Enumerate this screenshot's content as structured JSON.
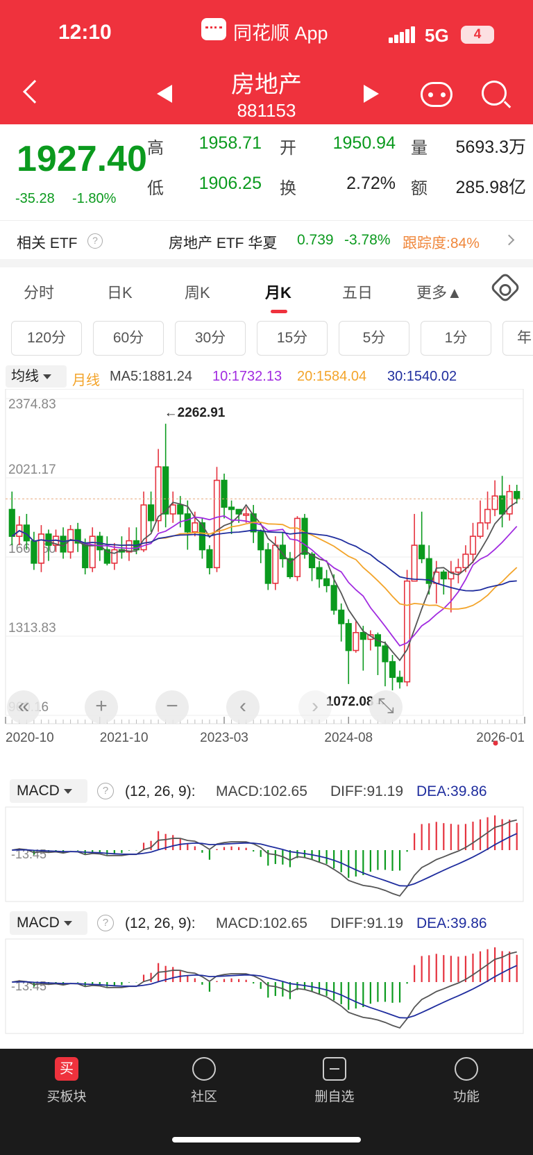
{
  "status_bar": {
    "time": "12:10",
    "app": "同花顺 App",
    "network": "5G",
    "battery": "4"
  },
  "header": {
    "title": "房地产",
    "code": "881153"
  },
  "quote": {
    "price": "1927.40",
    "change": "-35.28",
    "change_pct": "-1.80%",
    "high_label": "高",
    "high": "1958.71",
    "open_label": "开",
    "open": "1950.94",
    "volume_label": "量",
    "volume": "5693.3万",
    "low_label": "低",
    "low": "1906.25",
    "turnover_label": "换",
    "turnover": "2.72%",
    "amount_label": "额",
    "amount": "285.98亿"
  },
  "etf": {
    "label": "相关 ETF",
    "help": "?",
    "name": "房地产 ETF 华夏",
    "price": "0.739",
    "pct": "-3.78%",
    "tracking": "跟踪度:84%"
  },
  "tabs": [
    "分时",
    "日K",
    "周K",
    "月K",
    "五日",
    "更多▲"
  ],
  "active_tab": "月K",
  "periods": [
    "120分",
    "60分",
    "30分",
    "15分",
    "5分",
    "1分",
    "年"
  ],
  "ma": {
    "select": "均线",
    "type": "月线",
    "ma5": "MA5:1881.24",
    "ma10": "10:1732.13",
    "ma20": "20:1584.04",
    "ma30": "30:1540.02"
  },
  "colors": {
    "red": "#e5323e",
    "green": "#0b9a1e",
    "ma5": "#555555",
    "ma10": "#a12be0",
    "ma20": "#f3a42a",
    "ma30": "#1f2d9e"
  },
  "chart_labels": {
    "y_ticks": [
      "2374.83",
      "2021.17",
      "1667.50",
      "1313.83",
      "960.16"
    ],
    "high_marker": "←2262.91",
    "low_marker": "1072.08→",
    "x_ticks": [
      "2020-10",
      "2021-10",
      "2023-03",
      "2024-08",
      "2026-01"
    ]
  },
  "controls": [
    "«",
    "+",
    "−",
    "‹",
    "›",
    "⤡"
  ],
  "macd": {
    "select": "MACD",
    "help": "?",
    "params": "(12, 26, 9):",
    "macd": "MACD:102.65",
    "diff": "DIFF:91.19",
    "dea": "DEA:39.86",
    "axis": "-13.45"
  },
  "bottom_nav": [
    "买板块",
    "社区",
    "删自选",
    "功能"
  ],
  "chart_data": {
    "type": "candlestick",
    "period": "monthly",
    "ylim": [
      960.16,
      2374.83
    ],
    "y_ticks": [
      2374.83,
      2021.17,
      1667.5,
      1313.83,
      960.16
    ],
    "x_ticks": [
      "2020-10",
      "2021-10",
      "2023-03",
      "2024-08",
      "2026-01"
    ],
    "annotations": [
      {
        "label": "←2262.91",
        "value": 2262.91
      },
      {
        "label": "1072.08→",
        "value": 1072.08
      }
    ],
    "current_price": 1927.4,
    "ma_values": {
      "MA5": 1881.24,
      "MA10": 1732.13,
      "MA20": 1584.04,
      "MA30": 1540.02
    },
    "candles": [
      [
        1880,
        1760,
        1960,
        1720
      ],
      [
        1760,
        1810,
        1850,
        1720
      ],
      [
        1810,
        1740,
        1860,
        1700
      ],
      [
        1740,
        1640,
        1780,
        1610
      ],
      [
        1640,
        1770,
        1810,
        1600
      ],
      [
        1770,
        1720,
        1790,
        1650
      ],
      [
        1720,
        1760,
        1790,
        1690
      ],
      [
        1760,
        1690,
        1800,
        1660
      ],
      [
        1690,
        1790,
        1810,
        1660
      ],
      [
        1790,
        1730,
        1820,
        1690
      ],
      [
        1730,
        1620,
        1750,
        1590
      ],
      [
        1620,
        1760,
        1800,
        1600
      ],
      [
        1760,
        1700,
        1780,
        1650
      ],
      [
        1700,
        1640,
        1760,
        1630
      ],
      [
        1640,
        1700,
        1730,
        1610
      ],
      [
        1700,
        1690,
        1760,
        1660
      ],
      [
        1690,
        1740,
        1800,
        1650
      ],
      [
        1740,
        1700,
        1800,
        1680
      ],
      [
        1700,
        1900,
        1960,
        1690
      ],
      [
        1900,
        1830,
        1960,
        1780
      ],
      [
        1830,
        2070,
        2150,
        1780
      ],
      [
        2070,
        1860,
        2262.91,
        1800
      ],
      [
        1860,
        1900,
        1960,
        1820
      ],
      [
        1900,
        1860,
        1940,
        1800
      ],
      [
        1860,
        1780,
        1920,
        1700
      ],
      [
        1780,
        1820,
        1870,
        1760
      ],
      [
        1820,
        1700,
        1840,
        1660
      ],
      [
        1700,
        1620,
        1720,
        1590
      ],
      [
        1620,
        2010,
        2070,
        1600
      ],
      [
        2010,
        1890,
        2040,
        1840
      ],
      [
        1890,
        1880,
        1920,
        1770
      ],
      [
        1880,
        1860,
        1880,
        1820
      ],
      [
        1860,
        1860,
        1890,
        1820
      ],
      [
        1860,
        1780,
        1900,
        1730
      ],
      [
        1780,
        1700,
        1790,
        1640
      ],
      [
        1700,
        1550,
        1730,
        1520
      ],
      [
        1550,
        1720,
        1760,
        1520
      ],
      [
        1720,
        1660,
        1780,
        1620
      ],
      [
        1660,
        1580,
        1690,
        1570
      ],
      [
        1580,
        1840,
        1850,
        1560
      ],
      [
        1840,
        1680,
        1860,
        1660
      ],
      [
        1680,
        1620,
        1690,
        1560
      ],
      [
        1620,
        1570,
        1650,
        1530
      ],
      [
        1570,
        1540,
        1610,
        1510
      ],
      [
        1540,
        1430,
        1590,
        1410
      ],
      [
        1430,
        1370,
        1460,
        1290
      ],
      [
        1370,
        1250,
        1390,
        1100
      ],
      [
        1250,
        1330,
        1380,
        1240
      ],
      [
        1330,
        1300,
        1360,
        1160
      ],
      [
        1300,
        1320,
        1340,
        1250
      ],
      [
        1320,
        1270,
        1330,
        1140
      ],
      [
        1270,
        1200,
        1290,
        1090
      ],
      [
        1200,
        1130,
        1230,
        1072.08
      ],
      [
        1130,
        1110,
        1160,
        1080
      ],
      [
        1110,
        1560,
        1610,
        1090
      ],
      [
        1560,
        1720,
        1860,
        1600
      ],
      [
        1720,
        1660,
        1870,
        1640
      ],
      [
        1660,
        1550,
        1720,
        1500
      ],
      [
        1550,
        1600,
        1650,
        1460
      ],
      [
        1600,
        1570,
        1610,
        1500
      ],
      [
        1570,
        1600,
        1650,
        1420
      ],
      [
        1600,
        1620,
        1660,
        1550
      ],
      [
        1620,
        1680,
        1720,
        1600
      ],
      [
        1680,
        1760,
        1820,
        1640
      ],
      [
        1760,
        1820,
        1920,
        1750
      ],
      [
        1820,
        1880,
        1960,
        1790
      ],
      [
        1880,
        1940,
        2010,
        1850
      ],
      [
        1940,
        1860,
        2030,
        1800
      ],
      [
        1860,
        1960,
        1990,
        1830
      ],
      [
        1960,
        1927.4,
        1990,
        1906.25
      ]
    ]
  }
}
